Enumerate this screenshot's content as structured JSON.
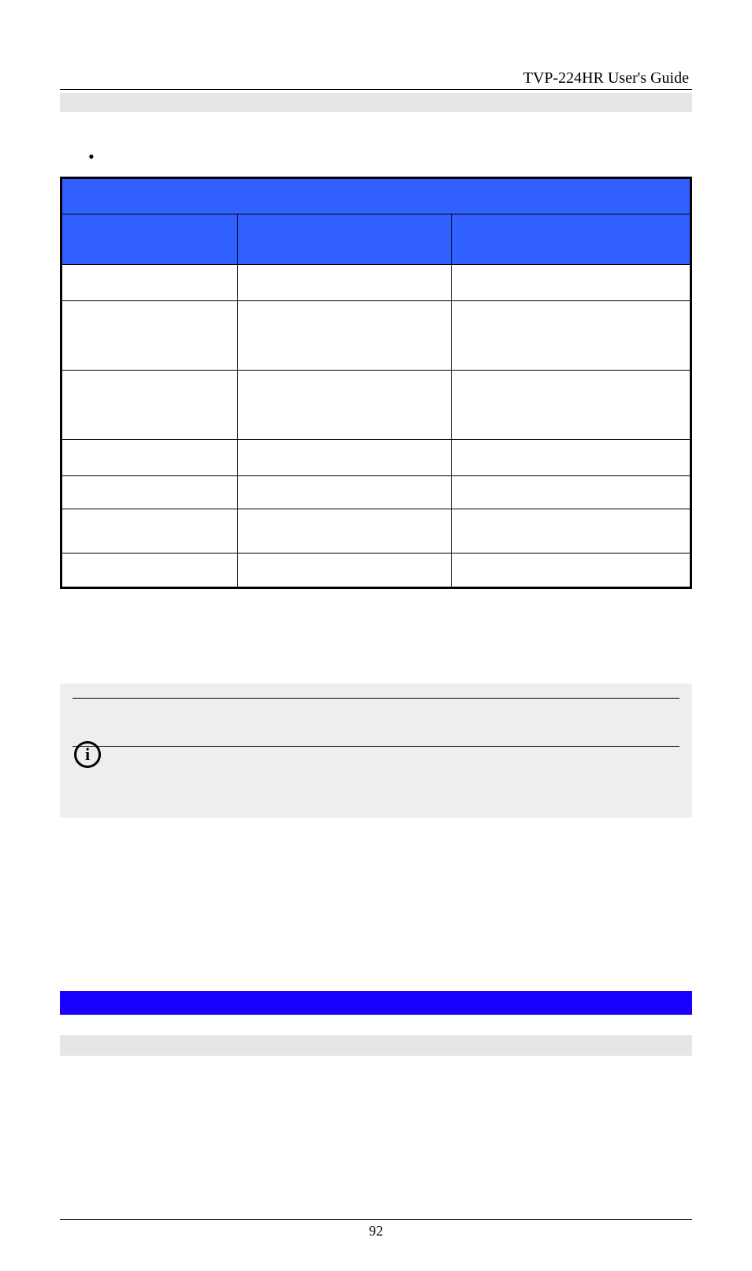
{
  "header": {
    "title": "TVP-224HR User's Guide"
  },
  "bullet": {
    "text": ""
  },
  "table": {
    "title": "",
    "headers": [
      "",
      "",
      ""
    ],
    "rows": [
      [
        "",
        "",
        ""
      ],
      [
        "",
        "",
        ""
      ],
      [
        "",
        "",
        ""
      ],
      [
        "",
        "",
        ""
      ],
      [
        "",
        "",
        ""
      ],
      [
        "",
        "",
        ""
      ],
      [
        "",
        "",
        ""
      ]
    ]
  },
  "note": {
    "icon_label": "info-icon",
    "text": ""
  },
  "footer": {
    "page_number": "92"
  }
}
